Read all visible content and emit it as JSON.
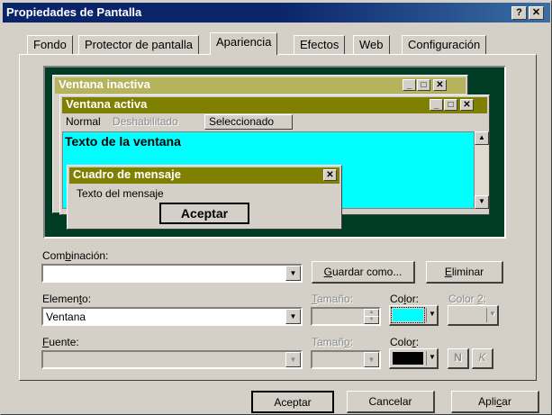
{
  "window": {
    "title": "Propiedades de Pantalla",
    "help_btn": "?",
    "close_btn": "✕"
  },
  "tabs": [
    {
      "label": "Fondo"
    },
    {
      "label": "Protector de pantalla"
    },
    {
      "label": "Apariencia"
    },
    {
      "label": "Efectos"
    },
    {
      "label": "Web"
    },
    {
      "label": "Configuración"
    }
  ],
  "preview": {
    "inactive_title": "Ventana inactiva",
    "active_title": "Ventana activa",
    "menu_normal": "Normal",
    "menu_disabled": "Deshabilitado",
    "menu_selected": "Seleccionado",
    "window_text": "Texto de la ventana",
    "msgbox_title": "Cuadro de mensaje",
    "msgbox_text": "Texto del mensaje",
    "msgbox_button": "Aceptar",
    "window_color": "#00ffff",
    "title_color": "#808000"
  },
  "scheme": {
    "label": "Combinación:",
    "value": "",
    "save_button": "Guardar como...",
    "delete_button": "Eliminar"
  },
  "element": {
    "label": "Elemento:",
    "value": "Ventana",
    "size_label": "Tamaño:",
    "size_value": "",
    "color_label": "Color:",
    "color_value": "#00ffff",
    "color2_label": "Color 2:"
  },
  "font": {
    "label": "Fuente:",
    "value": "",
    "size_label": "Tamaño:",
    "color_label": "Color:",
    "color_value": "#000000",
    "bold_btn": "N",
    "italic_btn": "K"
  },
  "footer": {
    "ok_button": "Aceptar",
    "cancel_button": "Cancelar",
    "apply_button": "Aplicar"
  }
}
